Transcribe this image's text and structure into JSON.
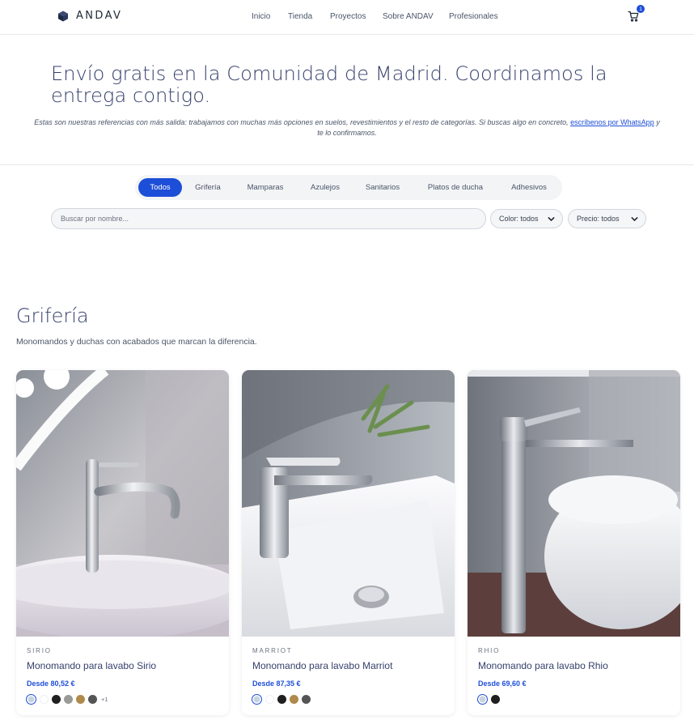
{
  "header": {
    "logo_text": "ANDAV",
    "nav": [
      "Inicio",
      "Tienda",
      "Proyectos",
      "Sobre ANDAV",
      "Profesionales"
    ],
    "cart_count": "1"
  },
  "hero": {
    "title": "Envío gratis en la Comunidad de Madrid. Coordinamos la entrega contigo.",
    "subtitle_before": "Estas son nuestras referencias con más salida: trabajamos con muchas más opciones en suelos, revestimientos y el resto de categorías. Si buscas algo en concreto,",
    "subtitle_link": "escríbenos por WhatsApp",
    "subtitle_after": "y te lo confirmamos."
  },
  "tabs": [
    "Todos",
    "Grifería",
    "Mamparas",
    "Azulejos",
    "Sanitarios",
    "Platos de ducha",
    "Adhesivos"
  ],
  "active_tab": "Todos",
  "filters": {
    "search_placeholder": "Buscar por nombre...",
    "color_label": "Color: todos",
    "price_label": "Precio: todos"
  },
  "section": {
    "title": "Grifería",
    "subtitle": "Monomandos y duchas con acabados que marcan la diferencia."
  },
  "products": [
    {
      "brand": "SIRIO",
      "name": "Monomando para lavabo Sirio",
      "price": "Desde 80,52 €",
      "swatches": [
        "#c9d3e0",
        "#ffffff",
        "#1f1f1f",
        "#9a9a96",
        "#b08a4a",
        "#555555"
      ],
      "more": "+1"
    },
    {
      "brand": "MARRIOT",
      "name": "Monomando para lavabo Marriot",
      "price": "Desde 87,35 €",
      "swatches": [
        "#c9d3e0",
        "#ffffff",
        "#1f1f1f",
        "#b08a4a",
        "#555555"
      ],
      "more": ""
    },
    {
      "brand": "RHIO",
      "name": "Monomando para lavabo Rhio",
      "price": "Desde 69,60 €",
      "swatches": [
        "#c9d3e0",
        "#1f1f1f"
      ],
      "more": ""
    }
  ],
  "colors": {
    "accent": "#1d4ed8",
    "heading": "#36416b"
  }
}
